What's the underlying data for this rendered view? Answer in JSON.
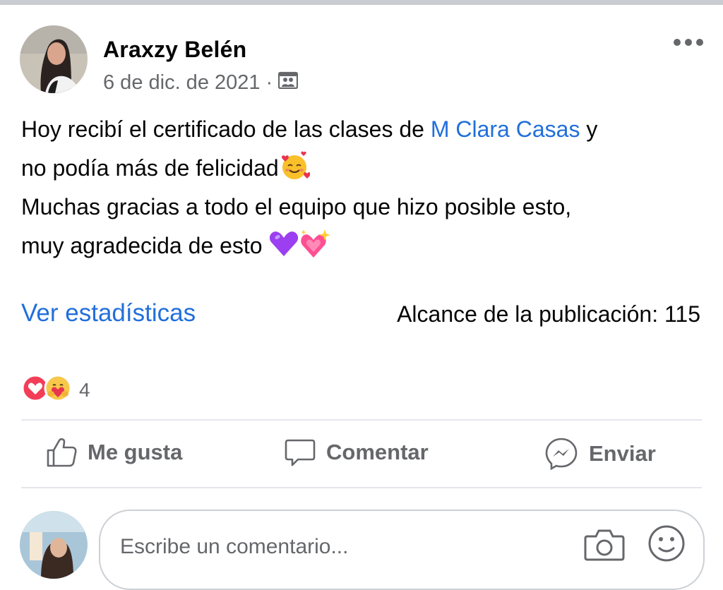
{
  "post": {
    "author": "Araxzy Belén",
    "date": "6 de dic. de 2021",
    "separator": "·",
    "audience_icon": "friends-icon",
    "text_line1_prefix": "Hoy recibí el certificado de las clases de ",
    "mention": "M Clara Casas",
    "text_line1_suffix": " y",
    "text_line2": "no podía más de felicidad",
    "text_line3": "Muchas gracias a todo el equipo que hizo posible esto,",
    "text_line4": "muy agradecida de esto ",
    "emojis": [
      "smiling-face-with-hearts",
      "purple-heart",
      "sparkling-heart"
    ]
  },
  "insights": {
    "link_label": "Ver estadísticas",
    "reach_label": "Alcance de la publicación: 115"
  },
  "reactions": {
    "icons": [
      "love-icon",
      "care-icon"
    ],
    "count": "4"
  },
  "actions": {
    "like": "Me gusta",
    "comment": "Comentar",
    "send": "Enviar"
  },
  "comment": {
    "placeholder": "Escribe un comentario..."
  },
  "colors": {
    "link": "#216fdb",
    "secondary_text": "#65676b",
    "divider": "#e4e6eb"
  }
}
